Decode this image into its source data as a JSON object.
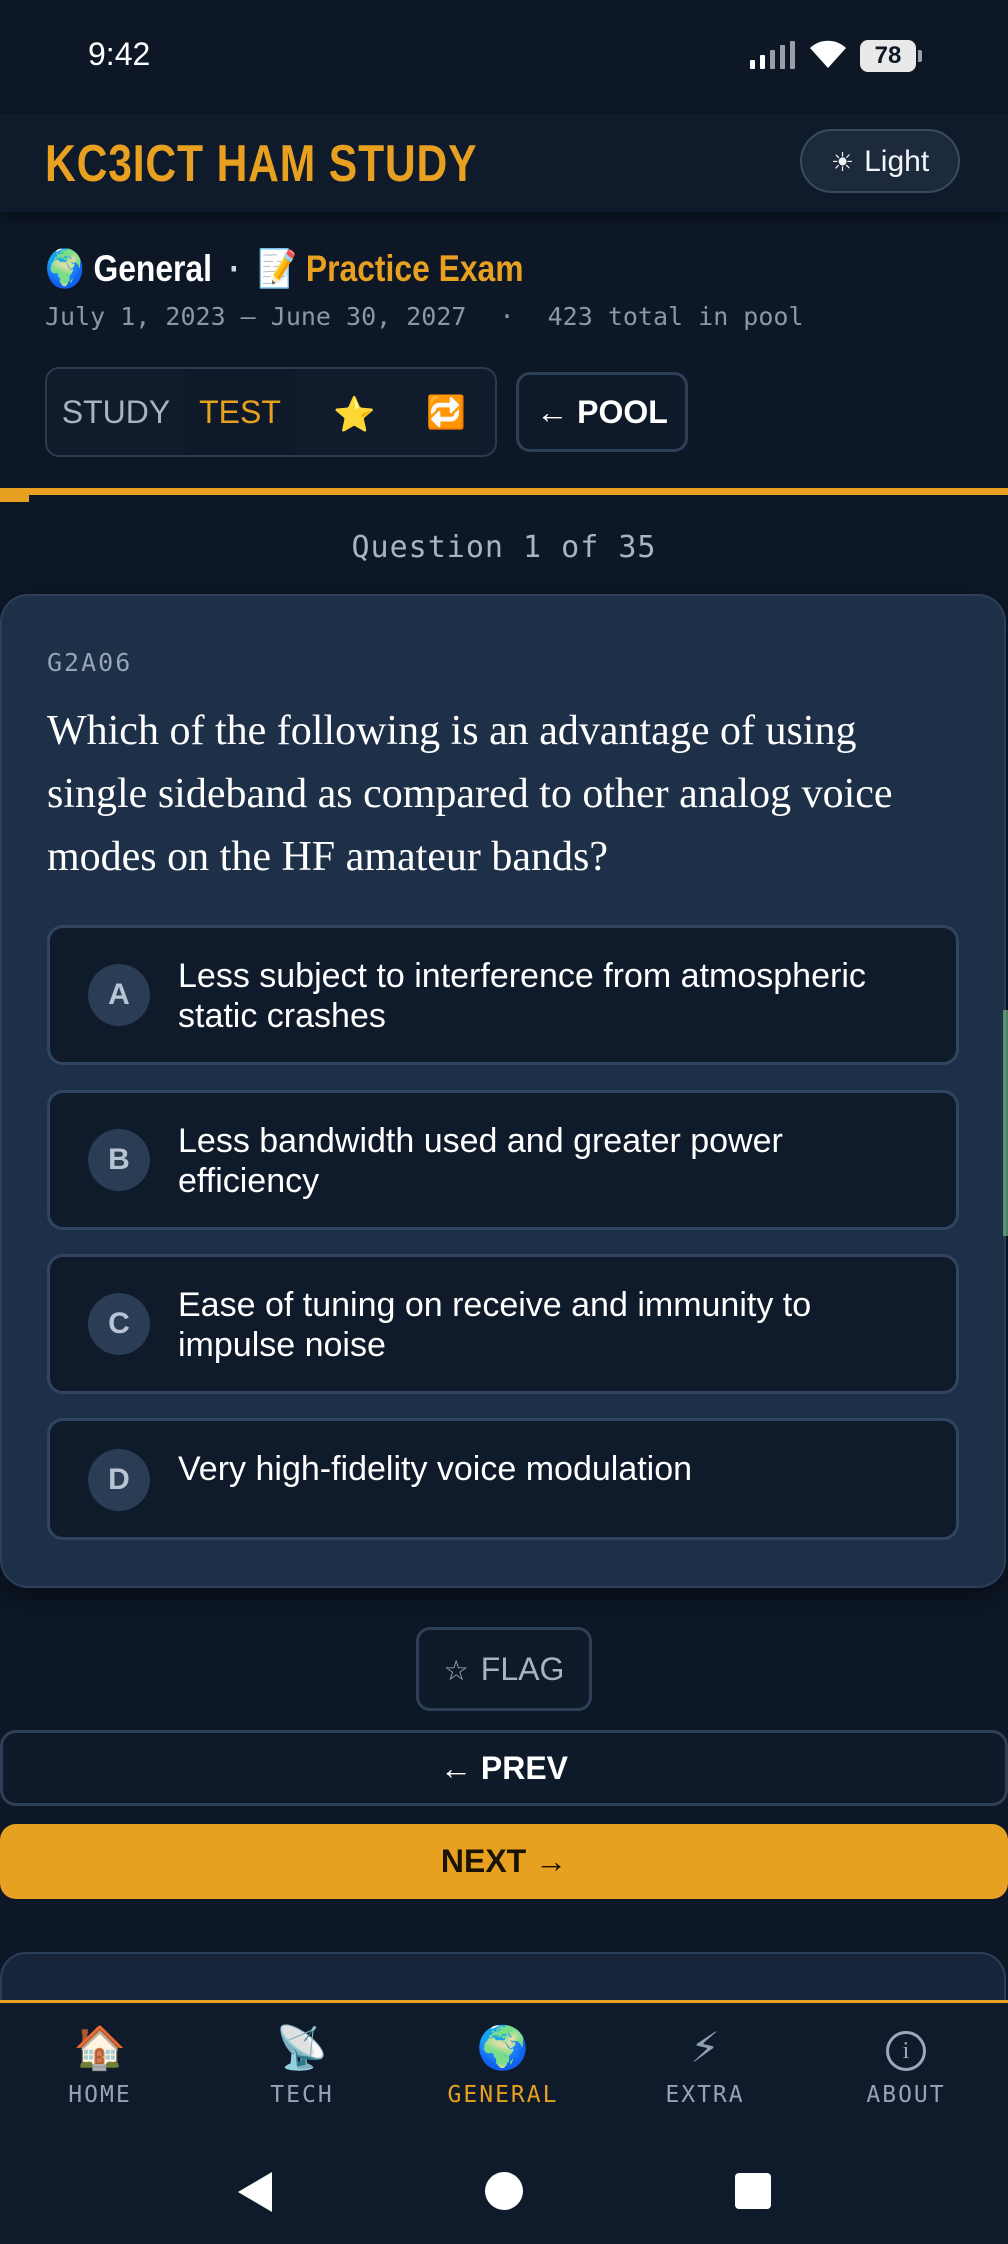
{
  "status": {
    "time": "9:42",
    "battery": "78"
  },
  "header": {
    "brand": "KC3ICT HAM STUDY",
    "theme_icon": "☀",
    "theme_label": "Light"
  },
  "subheader": {
    "pool_icon": "🌍",
    "pool_name": "General",
    "separator": "·",
    "mode_icon": "📝",
    "mode_name": "Practice Exam",
    "dates": "July 1, 2023 – June 30, 2027",
    "dot": "·",
    "pool_total": "423 total in pool"
  },
  "modes": {
    "study": "STUDY",
    "test": "TEST",
    "star": "⭐",
    "repeat": "🔁"
  },
  "pool_button": "← POOL",
  "progress": {
    "current": 1,
    "total": 35,
    "fraction": 0.0286
  },
  "question_counter": "Question 1 of 35",
  "question": {
    "id": "G2A06",
    "text": "Which of the following is an advantage of using single sideband as compared to other analog voice modes on the HF amateur bands?",
    "options": [
      {
        "letter": "A",
        "text": "Less subject to interference from atmospheric static crashes"
      },
      {
        "letter": "B",
        "text": "Less bandwidth used and greater power efficiency"
      },
      {
        "letter": "C",
        "text": "Ease of tuning on receive and immunity to impulse noise"
      },
      {
        "letter": "D",
        "text": "Very high-fidelity voice modulation"
      }
    ]
  },
  "actions": {
    "flag_icon": "☆",
    "flag": "FLAG",
    "prev": "← PREV",
    "next": "NEXT →"
  },
  "tabs": [
    {
      "icon": "🏠",
      "label": "HOME"
    },
    {
      "icon": "📡",
      "label": "TECH"
    },
    {
      "icon": "🌍",
      "label": "GENERAL"
    },
    {
      "icon": "⚡",
      "label": "EXTRA"
    },
    {
      "icon": "i",
      "label": "ABOUT"
    }
  ],
  "active_tab": "GENERAL",
  "colors": {
    "accent": "#e8a020",
    "background": "#0d1726",
    "card": "#1e3048"
  }
}
